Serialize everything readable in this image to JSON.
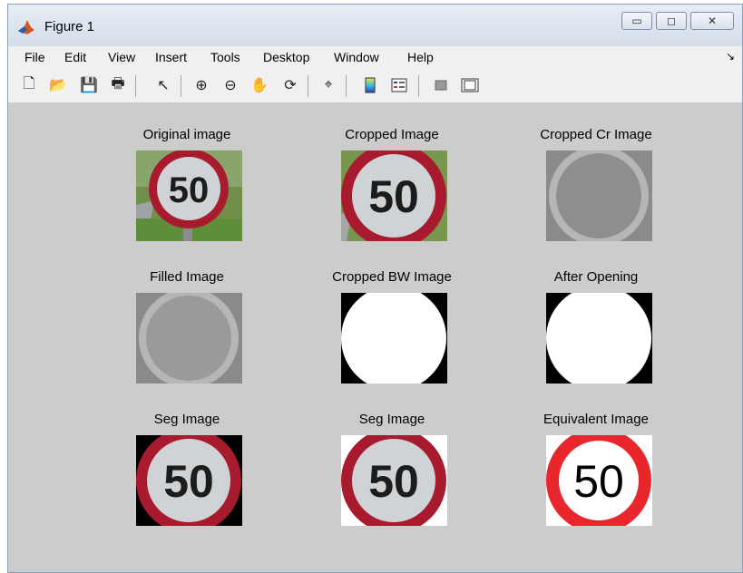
{
  "window": {
    "title": "Figure 1"
  },
  "menu": [
    "File",
    "Edit",
    "View",
    "Insert",
    "Tools",
    "Desktop",
    "Window",
    "Help"
  ],
  "toolbar_icons": [
    "new-figure-icon",
    "open-icon",
    "save-icon",
    "print-icon",
    "select-arrow-icon",
    "zoom-in-icon",
    "zoom-out-icon",
    "pan-icon",
    "rotate-3d-icon",
    "data-cursor-icon",
    "colorbar-icon",
    "legend-icon",
    "hide-plot-tools-icon",
    "show-plot-tools-icon"
  ],
  "panels": [
    {
      "title": "Original image"
    },
    {
      "title": "Cropped Image"
    },
    {
      "title": "Cropped Cr Image"
    },
    {
      "title": "Filled Image"
    },
    {
      "title": "Cropped BW Image"
    },
    {
      "title": "After Opening"
    },
    {
      "title": "Seg Image"
    },
    {
      "title": "Seg Image"
    },
    {
      "title": "Equivalent Image"
    }
  ],
  "sign_text": "50",
  "colors": {
    "figure_bg": "#cccccc",
    "sign_red": "#a5162b",
    "sign_bright_red": "#e8262b"
  }
}
